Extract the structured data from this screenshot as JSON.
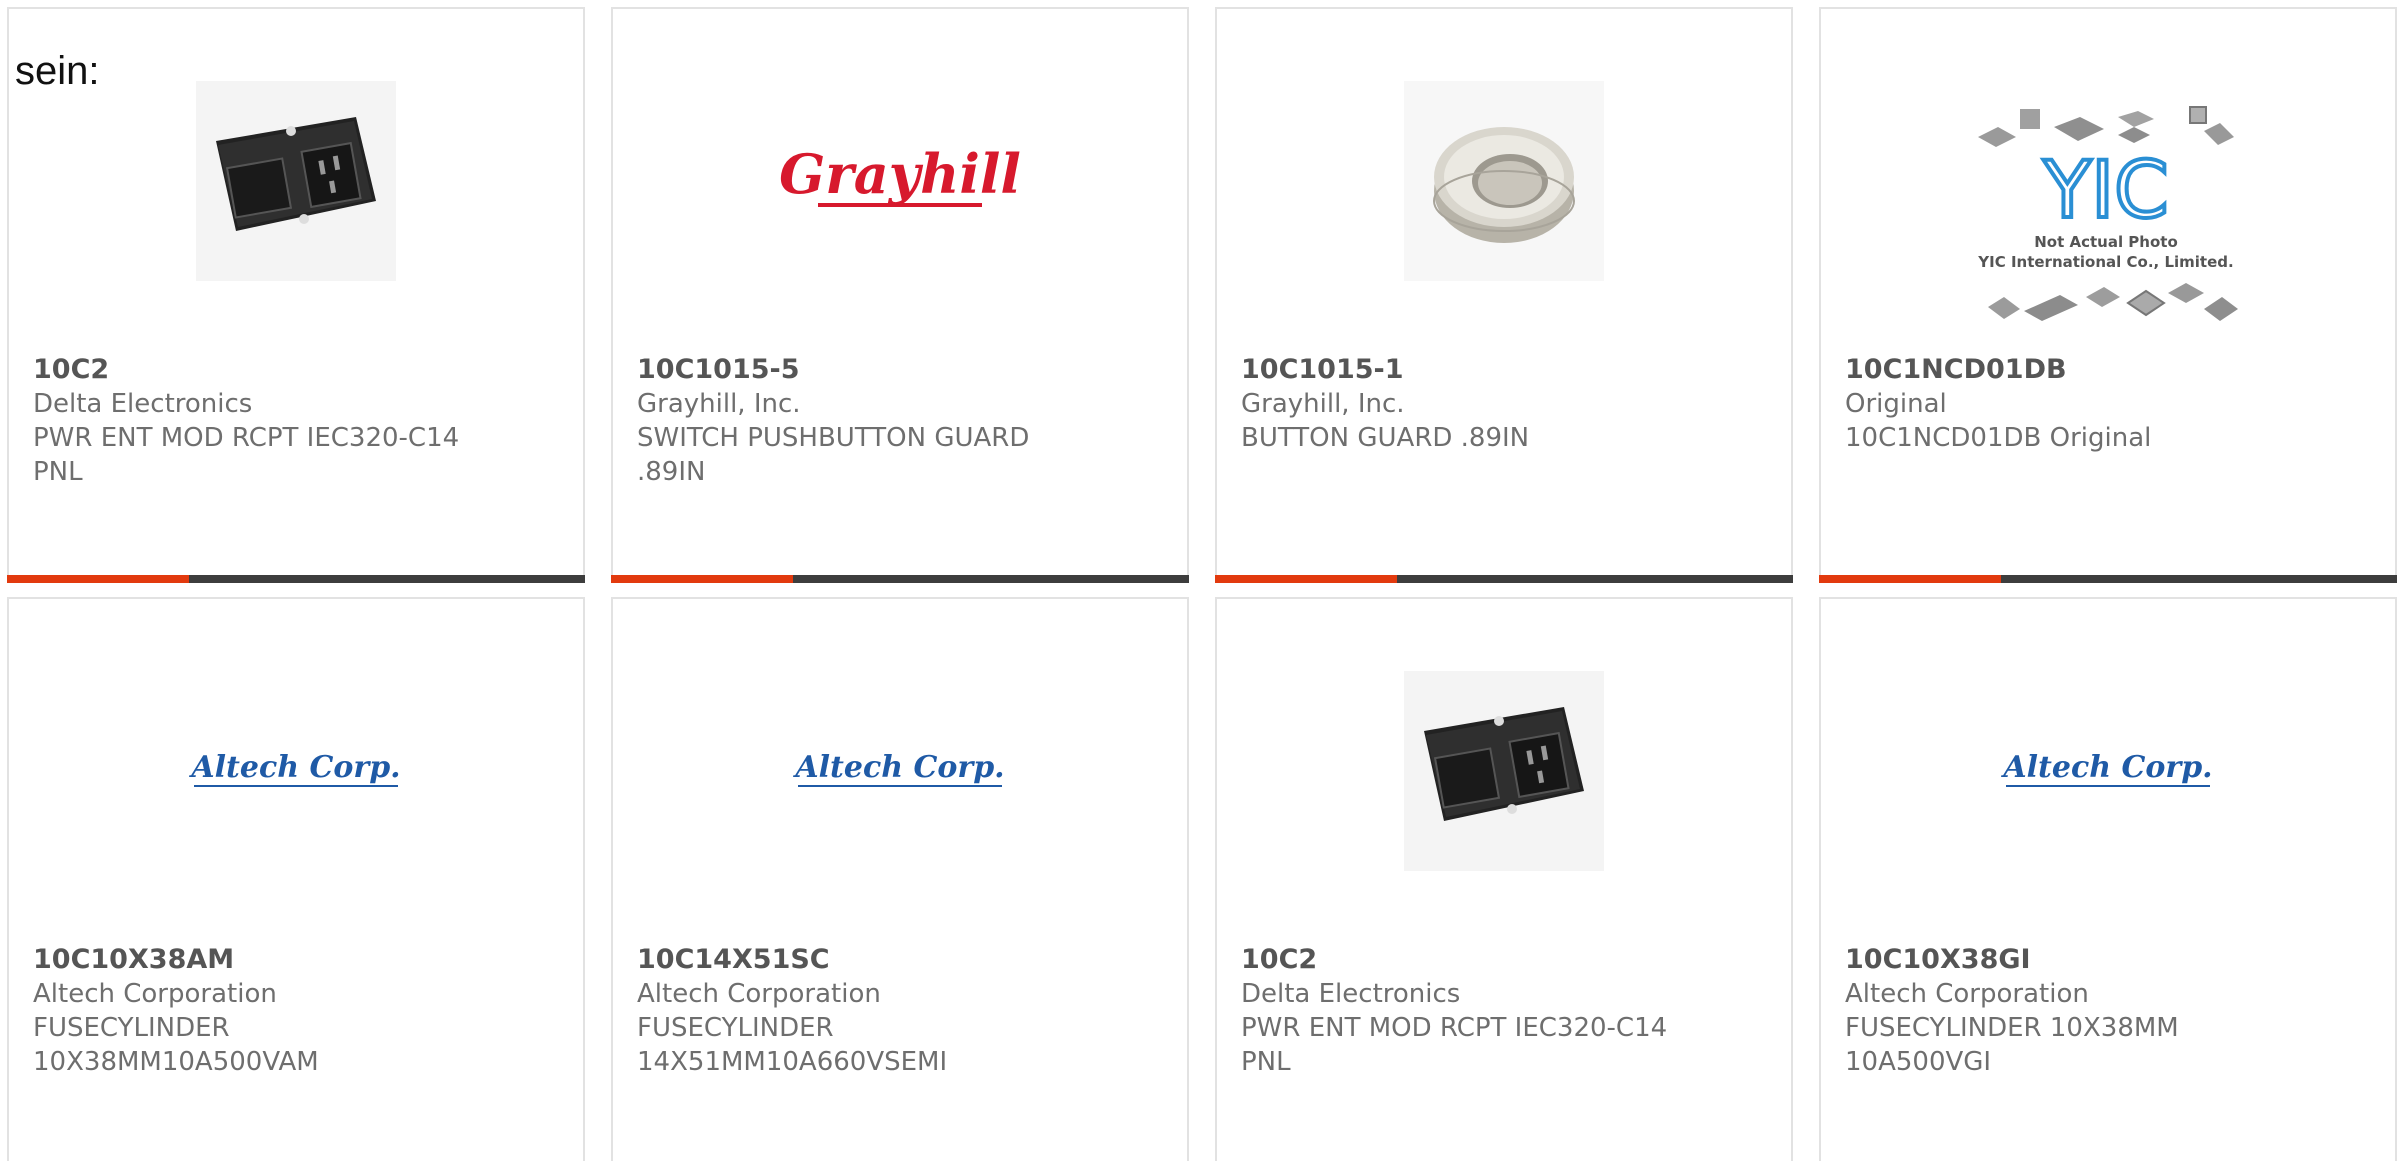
{
  "intro_text": "sein:",
  "cards": [
    {
      "part_number": "10C2",
      "manufacturer": "Delta Electronics",
      "description": "PWR ENT MOD RCPT IEC320-C14 PNL",
      "image": "power-entry-module-photo"
    },
    {
      "part_number": "10C1015-5",
      "manufacturer": "Grayhill, Inc.",
      "description": "SWITCH PUSHBUTTON GUARD .89IN",
      "image": "grayhill-logo",
      "logo_text": "Grayhill"
    },
    {
      "part_number": "10C1015-1",
      "manufacturer": "Grayhill, Inc.",
      "description": "BUTTON GUARD .89IN",
      "image": "button-guard-photo"
    },
    {
      "part_number": "10C1NCD01DB",
      "manufacturer": "Original",
      "description": "10C1NCD01DB Original",
      "image": "yic-placeholder",
      "logo_text": "YIC",
      "placeholder_line1": "Not Actual Photo",
      "placeholder_line2": "YIC International Co., Limited."
    },
    {
      "part_number": "10C10X38AM",
      "manufacturer": "Altech Corporation",
      "description": "FUSECYLINDER 10X38MM10A500VAM",
      "image": "altech-logo",
      "logo_text": "Altech Corp."
    },
    {
      "part_number": "10C14X51SC",
      "manufacturer": "Altech Corporation",
      "description": "FUSECYLINDER 14X51MM10A660VSEMI",
      "image": "altech-logo",
      "logo_text": "Altech Corp."
    },
    {
      "part_number": "10C2",
      "manufacturer": "Delta Electronics",
      "description": "PWR ENT MOD RCPT IEC320-C14 PNL",
      "image": "power-entry-module-photo"
    },
    {
      "part_number": "10C10X38GI",
      "manufacturer": "Altech Corporation",
      "description": "FUSECYLINDER 10X38MM 10A500VGI",
      "image": "altech-logo",
      "logo_text": "Altech Corp."
    }
  ],
  "colors": {
    "accent": "#e23a0e",
    "bar": "#3d3d3d",
    "border": "#e2e2e2",
    "grayhill_red": "#d7192d",
    "altech_blue": "#1f5aa6",
    "yic_blue": "#2a8fd4"
  }
}
